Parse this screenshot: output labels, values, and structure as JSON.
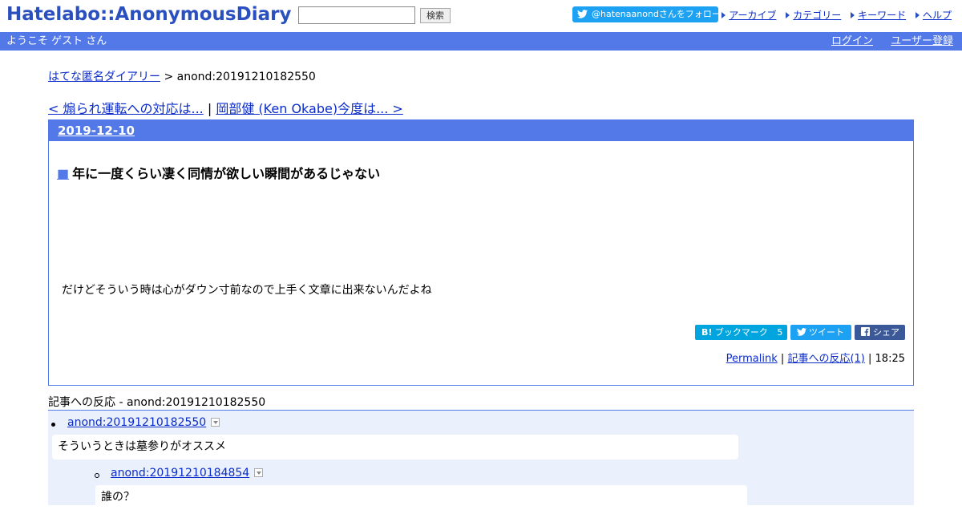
{
  "header": {
    "logo": "Hatelabo::AnonymousDiary",
    "search_button": "検索",
    "search_value": "",
    "follow_label": "@hatenaanondさんをフォロー",
    "links": [
      "アーカイブ",
      "カテゴリー",
      "キーワード",
      "ヘルプ"
    ]
  },
  "userbar": {
    "welcome": "ようこそ ゲスト さん",
    "login": "ログイン",
    "register": "ユーザー登録"
  },
  "breadcrumb": {
    "home": "はてな匿名ダイアリー",
    "separator": ">",
    "current": "anond:20191210182550"
  },
  "nav": {
    "prev": "< 煽られ運転への対応は...",
    "divider": "|",
    "next": "岡部健 (Ken Okabe)今度は... >"
  },
  "article": {
    "date": "2019-12-10",
    "title_marker": "■",
    "title": "年に一度くらい凄く同情が欲しい瞬間があるじゃない",
    "body": "だけどそういう時は心がダウン寸前なので上手く文章に出来ないんだよね",
    "share": {
      "hatena_b": "B!",
      "hatena_label": "ブックマーク",
      "hatena_count": "5",
      "tweet_label": "ツイート",
      "fb_label": "シェア"
    },
    "meta": {
      "permalink": "Permalink",
      "sep1": "|",
      "reactions_link": "記事への反応(1)",
      "sep2": "|",
      "time": "18:25"
    }
  },
  "reactions": {
    "heading": "記事への反応 - anond:20191210182550",
    "items": [
      {
        "id": "anond:20191210182550",
        "body": "そういうときは墓参りがオススメ"
      },
      {
        "id": "anond:20191210184854",
        "body": "誰の？"
      }
    ]
  }
}
